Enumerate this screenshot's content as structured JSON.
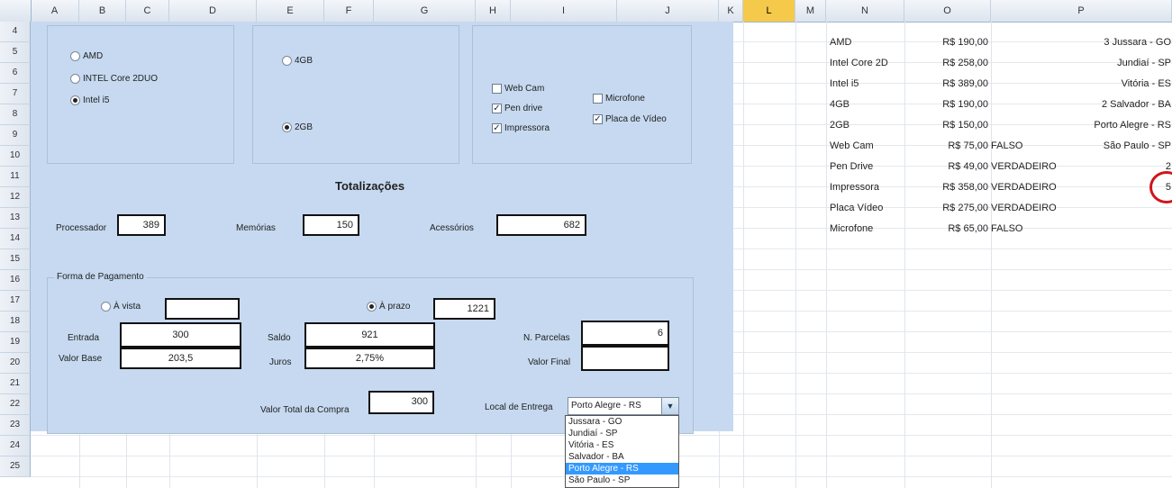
{
  "columns": [
    "A",
    "B",
    "C",
    "D",
    "E",
    "F",
    "G",
    "H",
    "I",
    "J",
    "K",
    "L",
    "M",
    "N",
    "O",
    "P"
  ],
  "selected_column": "L",
  "rows": [
    "4",
    "5",
    "6",
    "7",
    "8",
    "9",
    "10",
    "11",
    "12",
    "13",
    "14",
    "15",
    "16",
    "17",
    "18",
    "19",
    "20",
    "21",
    "22",
    "23",
    "24",
    "25"
  ],
  "processor": {
    "options": [
      {
        "label": "AMD",
        "selected": false
      },
      {
        "label": "INTEL Core 2DUO",
        "selected": false
      },
      {
        "label": "Intel i5",
        "selected": true
      }
    ]
  },
  "memory": {
    "options": [
      {
        "label": "4GB",
        "selected": false
      },
      {
        "label": "2GB",
        "selected": true
      }
    ]
  },
  "accessories": {
    "items": [
      {
        "label": "Web Cam",
        "checked": false
      },
      {
        "label": "Pen drive",
        "checked": true
      },
      {
        "label": "Impressora",
        "checked": true
      },
      {
        "label": "Microfone",
        "checked": false
      },
      {
        "label": "Placa de Vídeo",
        "checked": true
      }
    ]
  },
  "totals": {
    "title": "Totalizações",
    "processor_label": "Processador",
    "processor_value": "389",
    "memory_label": "Memórias",
    "memory_value": "150",
    "accessories_label": "Acessórios",
    "accessories_value": "682"
  },
  "payment": {
    "group_label": "Forma de Pagamento",
    "cash_label": "À vista",
    "cash_value": "",
    "cash_selected": false,
    "term_label": "À prazo",
    "term_value": "1221",
    "term_selected": true,
    "entrada_label": "Entrada",
    "entrada_value": "300",
    "saldo_label": "Saldo",
    "saldo_value": "921",
    "parcelas_label": "N. Parcelas",
    "parcelas_value": "6",
    "valor_base_label": "Valor Base",
    "valor_base_value": "203,5",
    "juros_label": "Juros",
    "juros_value": "2,75%",
    "valor_final_label": "Valor Final",
    "valor_final_value": "",
    "total_label": "Valor Total da Compra",
    "total_value": "300",
    "delivery_label": "Local de Entrega",
    "delivery_value": "Porto Alegre - RS",
    "delivery_options": [
      "Jussara - GO",
      "Jundiaí - SP",
      "Vitória - ES",
      "Salvador - BA",
      "Porto Alegre - RS",
      "São Paulo - SP"
    ],
    "delivery_selected_index": 4
  },
  "sheet": {
    "items": [
      {
        "name": "AMD",
        "price": "R$ 190,00",
        "flag": "",
        "p": "3 Jussara - GO"
      },
      {
        "name": "Intel Core 2D",
        "price": "R$ 258,00",
        "flag": "",
        "p": "Jundiaí - SP"
      },
      {
        "name": "Intel i5",
        "price": "R$ 389,00",
        "flag": "",
        "p": "Vitória - ES"
      },
      {
        "name": "4GB",
        "price": "R$ 190,00",
        "flag": "",
        "p": "2 Salvador - BA"
      },
      {
        "name": "2GB",
        "price": "R$ 150,00",
        "flag": "",
        "p": "Porto Alegre - RS"
      },
      {
        "name": "Web Cam",
        "price": "R$ 75,00",
        "flag": "FALSO",
        "p": "São Paulo - SP"
      },
      {
        "name": "Pen Drive",
        "price": "R$ 49,00",
        "flag": "VERDADEIRO",
        "p": "2"
      },
      {
        "name": "Impressora",
        "price": "R$ 358,00",
        "flag": "VERDADEIRO",
        "p": "5"
      },
      {
        "name": "Placa Vídeo",
        "price": "R$ 275,00",
        "flag": "VERDADEIRO",
        "p": ""
      },
      {
        "name": "Microfone",
        "price": "R$ 65,00",
        "flag": "FALSO",
        "p": ""
      }
    ]
  }
}
